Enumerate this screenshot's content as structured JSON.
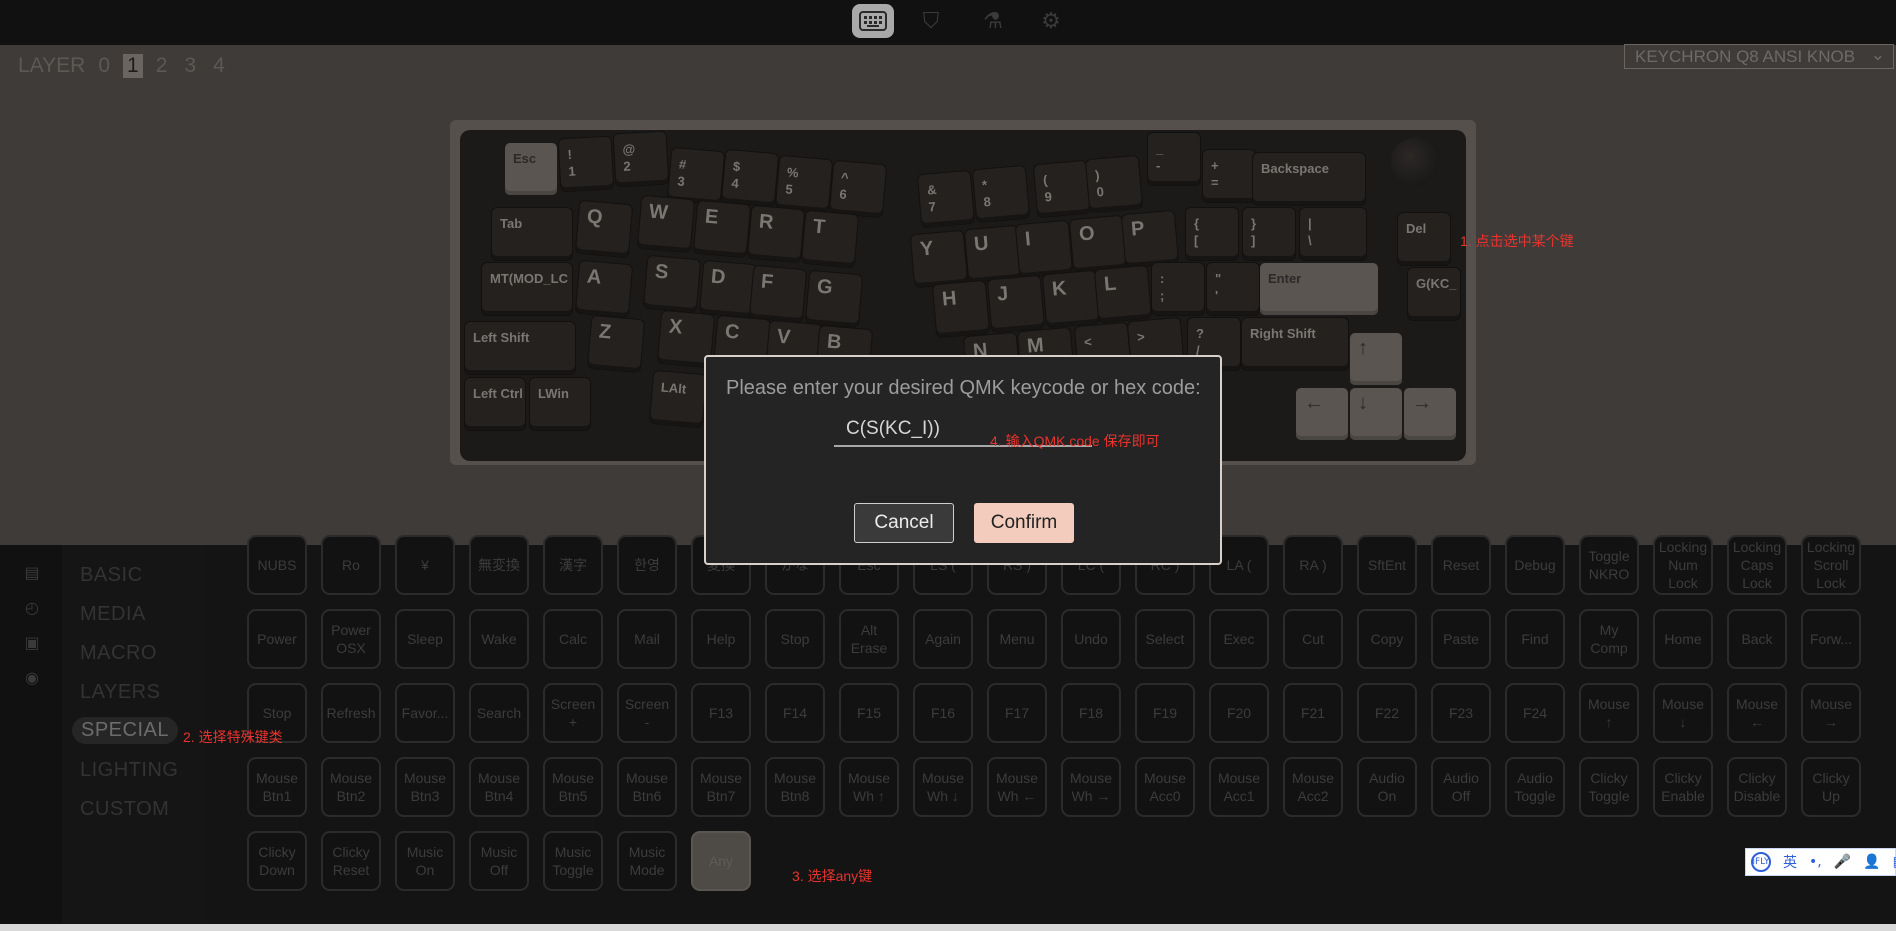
{
  "topbar": {
    "icons": [
      "keyboard-icon",
      "shield-icon",
      "flask-icon",
      "gear-icon"
    ],
    "active_icon": "keyboard-icon"
  },
  "layer_selector": {
    "label": "LAYER",
    "layers": [
      "0",
      "1",
      "2",
      "3",
      "4"
    ],
    "selected": "1"
  },
  "keyboard_select": {
    "value": "KEYCHRON Q8 ANSI KNOB",
    "chevron": "⌄"
  },
  "keyboard_keys": [
    {
      "label": "Esc",
      "style": "light"
    },
    {
      "label": "!\n1"
    },
    {
      "label": "@\n2"
    },
    {
      "label": "#\n3"
    },
    {
      "label": "$\n4"
    },
    {
      "label": "%\n5"
    },
    {
      "label": "^\n6"
    },
    {
      "label": "&\n7"
    },
    {
      "label": "*\n8"
    },
    {
      "label": "(\n9"
    },
    {
      "label": ")\n0"
    },
    {
      "label": "_\n-"
    },
    {
      "label": "+\n="
    },
    {
      "label": "Backspace"
    },
    {
      "label": "Tab"
    },
    {
      "label": "Q"
    },
    {
      "label": "W"
    },
    {
      "label": "E"
    },
    {
      "label": "R"
    },
    {
      "label": "T"
    },
    {
      "label": "Y"
    },
    {
      "label": "U"
    },
    {
      "label": "I"
    },
    {
      "label": "O"
    },
    {
      "label": "P"
    },
    {
      "label": "{\n["
    },
    {
      "label": "}\n]"
    },
    {
      "label": "|\n\\"
    },
    {
      "label": "Del"
    },
    {
      "label": "MT(MOD_LC"
    },
    {
      "label": "A"
    },
    {
      "label": "S"
    },
    {
      "label": "D"
    },
    {
      "label": "F"
    },
    {
      "label": "G"
    },
    {
      "label": "H"
    },
    {
      "label": "J"
    },
    {
      "label": "K"
    },
    {
      "label": "L"
    },
    {
      "label": ":\n;"
    },
    {
      "label": "\"\n'"
    },
    {
      "label": "Enter",
      "style": "light"
    },
    {
      "label": "G(KC_"
    },
    {
      "label": "Left Shift"
    },
    {
      "label": "Z"
    },
    {
      "label": "X"
    },
    {
      "label": "C"
    },
    {
      "label": "V"
    },
    {
      "label": "B"
    },
    {
      "label": "N"
    },
    {
      "label": "M"
    },
    {
      "label": "<\n,"
    },
    {
      "label": ">\n."
    },
    {
      "label": "?\n/"
    },
    {
      "label": "Right Shift"
    },
    {
      "label": "↑",
      "style": "light"
    },
    {
      "label": "Left Ctrl"
    },
    {
      "label": "LWin"
    },
    {
      "label": "LAlt"
    },
    {
      "label": "←",
      "style": "light"
    },
    {
      "label": "↓",
      "style": "light"
    },
    {
      "label": "→",
      "style": "light"
    }
  ],
  "annotations": {
    "step1": "1. 点击选中某个键",
    "step2": "2. 选择特殊键类",
    "step3": "3. 选择any键",
    "step4": "4. 输入QMK code 保存即可"
  },
  "side_icons": [
    "book-icon",
    "clock-icon",
    "save-icon",
    "bulb-icon"
  ],
  "menu": {
    "items": [
      "BASIC",
      "MEDIA",
      "MACRO",
      "LAYERS",
      "SPECIAL",
      "LIGHTING",
      "CUSTOM"
    ],
    "selected": "SPECIAL"
  },
  "keycode_rows": [
    [
      "NUBS",
      "Ro",
      "¥",
      "無変換",
      "漢字",
      "한영",
      "変換",
      "かな",
      "Esc",
      "LS (",
      "RS )",
      "LC (",
      "RC )",
      "LA (",
      "RA )",
      "SftEnt",
      "Reset",
      "Debug",
      "Toggle\nNKRO",
      "Locking\nNum\nLock",
      "Locking\nCaps\nLock",
      "Locking\nScroll\nLock"
    ],
    [
      "Power",
      "Power\nOSX",
      "Sleep",
      "Wake",
      "Calc",
      "Mail",
      "Help",
      "Stop",
      "Alt\nErase",
      "Again",
      "Menu",
      "Undo",
      "Select",
      "Exec",
      "Cut",
      "Copy",
      "Paste",
      "Find",
      "My\nComp",
      "Home",
      "Back",
      "Forw..."
    ],
    [
      "Stop",
      "Refresh",
      "Favor...",
      "Search",
      "Screen\n+",
      "Screen\n-",
      "F13",
      "F14",
      "F15",
      "F16",
      "F17",
      "F18",
      "F19",
      "F20",
      "F21",
      "F22",
      "F23",
      "F24",
      "Mouse\n↑",
      "Mouse\n↓",
      "Mouse\n←",
      "Mouse\n→"
    ],
    [
      "Mouse\nBtn1",
      "Mouse\nBtn2",
      "Mouse\nBtn3",
      "Mouse\nBtn4",
      "Mouse\nBtn5",
      "Mouse\nBtn6",
      "Mouse\nBtn7",
      "Mouse\nBtn8",
      "Mouse\nWh ↑",
      "Mouse\nWh ↓",
      "Mouse\nWh ←",
      "Mouse\nWh →",
      "Mouse\nAcc0",
      "Mouse\nAcc1",
      "Mouse\nAcc2",
      "Audio\nOn",
      "Audio\nOff",
      "Audio\nToggle",
      "Clicky\nToggle",
      "Clicky\nEnable",
      "Clicky\nDisable",
      "Clicky\nUp"
    ],
    [
      "Clicky\nDown",
      "Clicky\nReset",
      "Music\nOn",
      "Music\nOff",
      "Music\nToggle",
      "Music\nMode",
      "Any"
    ]
  ],
  "modal": {
    "title": "Please enter your desired QMK keycode or hex code:",
    "input_value": "C(S(KC_I))",
    "cancel_label": "Cancel",
    "confirm_label": "Confirm"
  },
  "ime_bar": {
    "items": [
      "iFLY",
      "英",
      "•,",
      "🎤",
      "👤",
      "▦"
    ]
  },
  "colors": {
    "accent": "#f3ccbd",
    "annotation": "#e8332e",
    "overlay_bg": "#3e3b39"
  }
}
